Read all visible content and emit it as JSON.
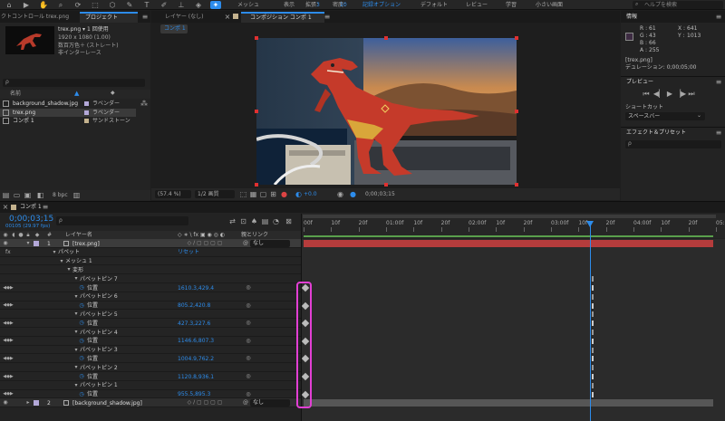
{
  "toolbar": {
    "workspaces": [
      "メッシュ",
      "拡張：",
      "密度：",
      "記録オプション",
      "デフォルト",
      "レビュー",
      "学習",
      "小さい画面"
    ],
    "show_label": "表示",
    "extend_value": "3",
    "density_value": "10",
    "help_placeholder": "ヘルプを検索"
  },
  "project": {
    "tab_effects": "クトコントロール trex.png",
    "tab_project": "プロジェクト",
    "file_name": "trex.png ▾ 1 回使用",
    "file_dims": "1920 x 1080 (1.00)",
    "file_color": "数百万色＋ (ストレート)",
    "file_interlace": "非インターレース",
    "search_placeholder": "ρ",
    "col_name": "名前",
    "items": [
      {
        "name": "background_shadow.jpg",
        "label": "ラベンダー",
        "color": "#b3a8d8"
      },
      {
        "name": "trex.png",
        "label": "ラベンダー",
        "color": "#b3a8d8"
      },
      {
        "name": "コンポ 1",
        "label": "サンドストーン",
        "color": "#c4b28e"
      }
    ],
    "bpc": "8 bpc"
  },
  "layer_panel": {
    "tab": "レイヤー (なし)"
  },
  "comp_panel": {
    "tab": "コンポジション コンポ 1",
    "sub_tab": "コンポ 1",
    "zoom": "(57.4 %)",
    "resolution": "1/2 画質",
    "exposure": "+0.0",
    "timecode": "0;00;03;15"
  },
  "info": {
    "title": "情報",
    "r_label": "R :",
    "r": "61",
    "g_label": "G :",
    "g": "43",
    "b_label": "B :",
    "b": "66",
    "a_label": "A :",
    "a": "255",
    "x_label": "X :",
    "x": "641",
    "y_label": "Y :",
    "y": "1013",
    "file": "[trex.png]",
    "time": "デュレーション: 0;00;05;00"
  },
  "preview": {
    "title": "プレビュー"
  },
  "shortcut": {
    "label": "ショートカット",
    "value": "スペースバー"
  },
  "effects": {
    "title": "エフェクト＆プリセット",
    "search_placeholder": "ρ"
  },
  "timeline": {
    "tab": "コンポ 1",
    "timecode": "0;00;03;15",
    "frame": "00105 (29.97 fps)",
    "search_placeholder": "ρ",
    "col_layer": "レイヤー名",
    "col_parent": "親とリンク",
    "col_switches": "◇ ∗ \\ fx ▣ ◉ ◎ ◐",
    "ruler": [
      "00f",
      "10f",
      "20f",
      "01:00f",
      "10f",
      "20f",
      "02:00f",
      "10f",
      "20f",
      "03:00f",
      "10f",
      "20f",
      "04:00f",
      "10f",
      "20f",
      "05:0"
    ],
    "playhead_fraction": 0.7,
    "layers": [
      {
        "type": "layer",
        "indent": 0,
        "num": "1",
        "name": "[trex.png]",
        "parent": "なし",
        "selected": true
      },
      {
        "type": "group",
        "indent": 1,
        "name": "パペット",
        "value": "リセット"
      },
      {
        "type": "group",
        "indent": 2,
        "name": "メッシュ 1"
      },
      {
        "type": "group",
        "indent": 3,
        "name": "変形"
      },
      {
        "type": "group",
        "indent": 4,
        "name": "パペットピン 7"
      },
      {
        "type": "prop",
        "indent": 5,
        "name": "位置",
        "value": "1610.3,429.4",
        "kf": true
      },
      {
        "type": "group",
        "indent": 4,
        "name": "パペットピン 6"
      },
      {
        "type": "prop",
        "indent": 5,
        "name": "位置",
        "value": "805.2,420.8",
        "kf": true
      },
      {
        "type": "group",
        "indent": 4,
        "name": "パペットピン 5"
      },
      {
        "type": "prop",
        "indent": 5,
        "name": "位置",
        "value": "427.3,227.6",
        "kf": true
      },
      {
        "type": "group",
        "indent": 4,
        "name": "パペットピン 4"
      },
      {
        "type": "prop",
        "indent": 5,
        "name": "位置",
        "value": "1146.6,807.3",
        "kf": true
      },
      {
        "type": "group",
        "indent": 4,
        "name": "パペットピン 3"
      },
      {
        "type": "prop",
        "indent": 5,
        "name": "位置",
        "value": "1004.9,762.2",
        "kf": true
      },
      {
        "type": "group",
        "indent": 4,
        "name": "パペットピン 2"
      },
      {
        "type": "prop",
        "indent": 5,
        "name": "位置",
        "value": "1120.8,936.1",
        "kf": true
      },
      {
        "type": "group",
        "indent": 4,
        "name": "パペットピン 1"
      },
      {
        "type": "prop",
        "indent": 5,
        "name": "位置",
        "value": "955.5,895.3",
        "kf": true
      },
      {
        "type": "layer",
        "indent": 0,
        "num": "2",
        "name": "[background_shadow.jpg]",
        "parent": "なし",
        "selected": false
      }
    ]
  },
  "colors": {
    "accent": "#2d8ceb",
    "layer_bar": "#b53c3c",
    "label_lavender": "#b3a8d8",
    "highlight": "#e23fd4"
  }
}
